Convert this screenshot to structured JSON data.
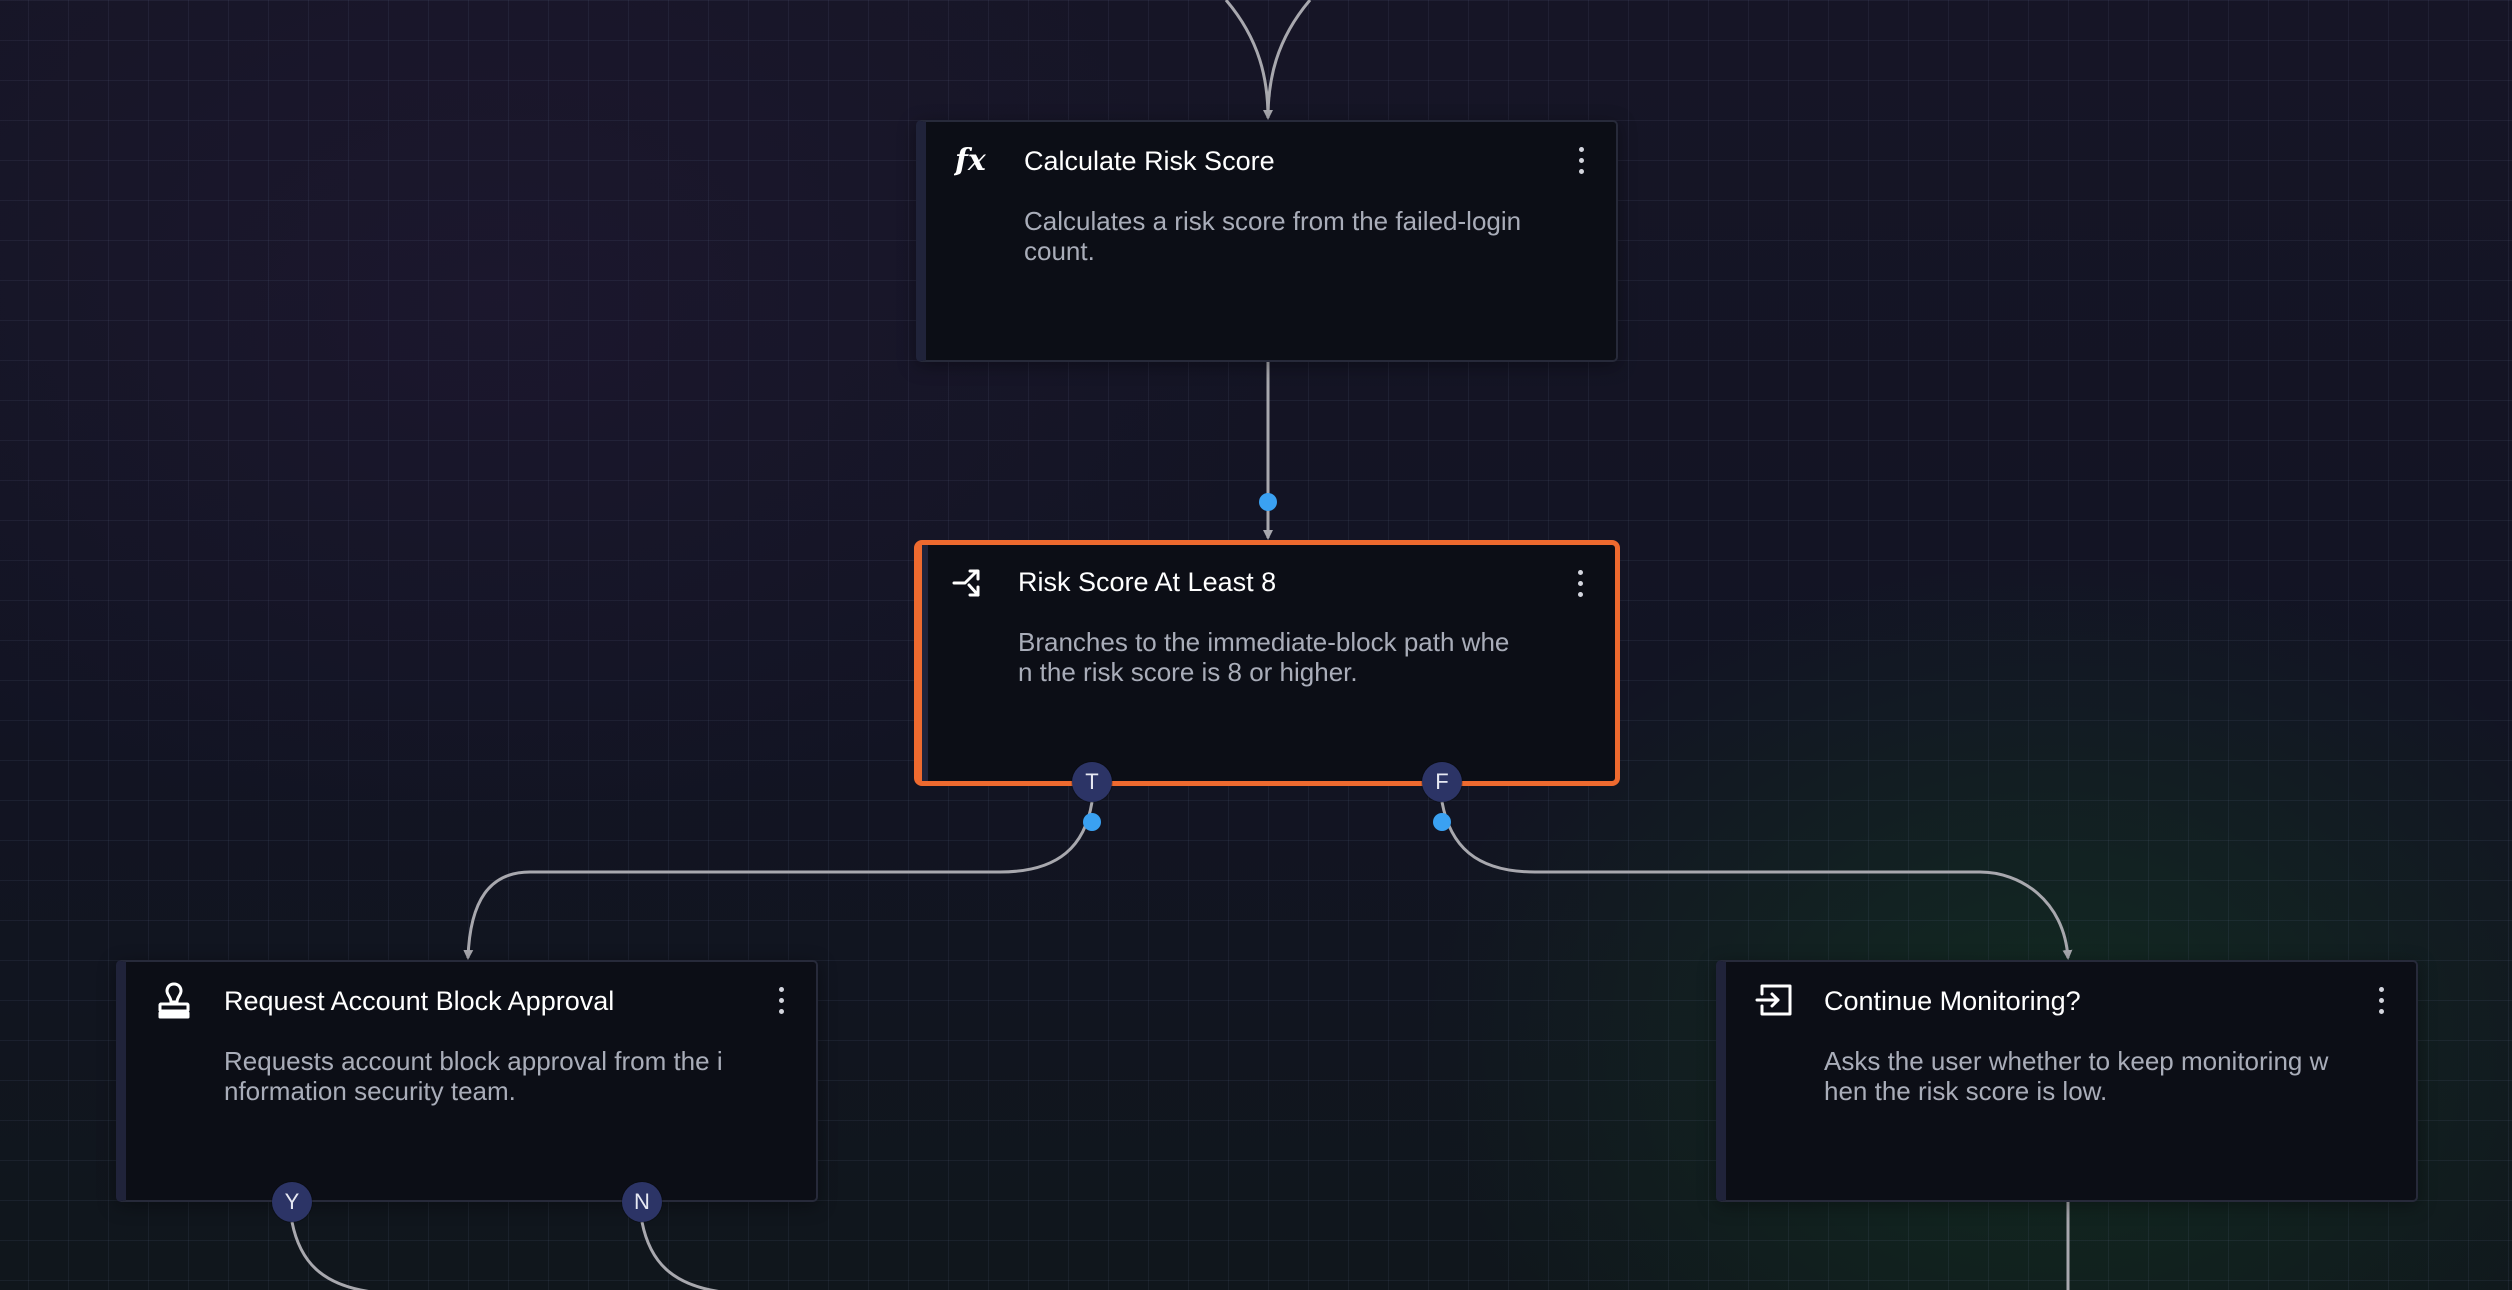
{
  "nodes": [
    {
      "id": "calculate",
      "icon": "function-icon",
      "title": "Calculate Risk Score",
      "description": "Calculates a risk score from the failed-login count."
    },
    {
      "id": "condition",
      "icon": "branch-icon",
      "title": "Risk Score At Least 8",
      "description": "Branches to the immediate-block path when the risk score is 8 or higher.",
      "selected": true
    },
    {
      "id": "approval",
      "icon": "approval-stamp-icon",
      "title": "Request Account Block Approval",
      "description": "Requests account block approval from the information security team."
    },
    {
      "id": "continue",
      "icon": "sign-in-icon",
      "title": "Continue Monitoring?",
      "description": "Asks the user whether to keep monitoring when the risk score is low."
    }
  ],
  "ports": {
    "condition_true": "T",
    "condition_false": "F",
    "approval_yes": "Y",
    "approval_no": "N"
  },
  "colors": {
    "selected_border": "#ee6a2f",
    "port_fill": "#2c3466",
    "connector_dot": "#3aa1f2",
    "edge": "#a8a8ae"
  }
}
